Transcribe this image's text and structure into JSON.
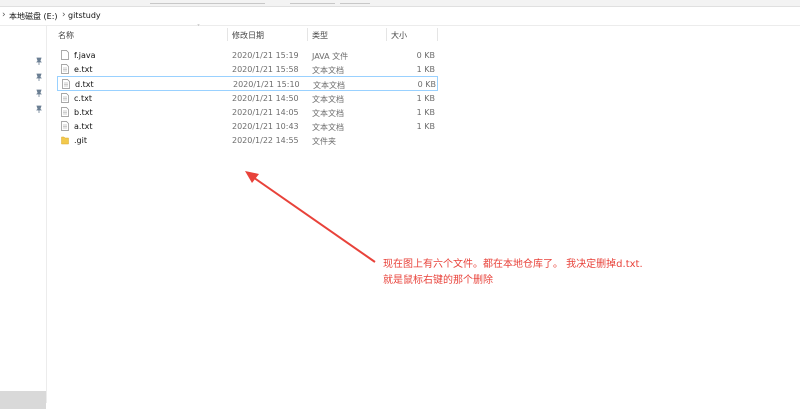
{
  "address": {
    "crumbs": [
      "本地磁盘 (E:)",
      "gitstudy"
    ],
    "separator": "›"
  },
  "columns": {
    "name": "名称",
    "date": "修改日期",
    "type": "类型",
    "size": "大小"
  },
  "files": [
    {
      "name": "f.java",
      "date": "2020/1/21 15:19",
      "type": "JAVA 文件",
      "size": "0 KB",
      "icon": "file-icon",
      "selected": false
    },
    {
      "name": "e.txt",
      "date": "2020/1/21 15:58",
      "type": "文本文档",
      "size": "1 KB",
      "icon": "text-file-icon",
      "selected": false
    },
    {
      "name": "d.txt",
      "date": "2020/1/21 15:10",
      "type": "文本文档",
      "size": "0 KB",
      "icon": "text-file-icon",
      "selected": true
    },
    {
      "name": "c.txt",
      "date": "2020/1/21 14:50",
      "type": "文本文档",
      "size": "1 KB",
      "icon": "text-file-icon",
      "selected": false
    },
    {
      "name": "b.txt",
      "date": "2020/1/21 14:05",
      "type": "文本文档",
      "size": "1 KB",
      "icon": "text-file-icon",
      "selected": false
    },
    {
      "name": "a.txt",
      "date": "2020/1/21 10:43",
      "type": "文本文档",
      "size": "1 KB",
      "icon": "text-file-icon",
      "selected": false
    },
    {
      "name": ".git",
      "date": "2020/1/22 14:55",
      "type": "文件夹",
      "size": "",
      "icon": "folder-icon",
      "selected": false
    }
  ],
  "annotation": {
    "line1": "现在图上有六个文件。都在本地仓库了。 我决定删掉d.txt.",
    "line2": "就是鼠标右键的那个删除"
  },
  "colors": {
    "annotation": "#e8423a",
    "selection_border": "#99d1ff",
    "folder": "#f2c94c"
  }
}
